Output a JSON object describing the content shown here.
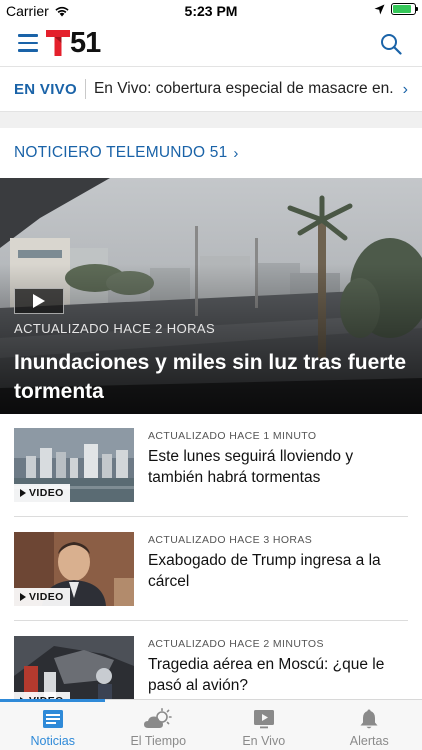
{
  "status_bar": {
    "carrier": "Carrier",
    "time": "5:23 PM",
    "battery_level": 0.85
  },
  "header": {
    "logo_number": "51"
  },
  "live": {
    "tag": "EN VIVO",
    "text": "En Vivo: cobertura especial de masacre en..."
  },
  "section": {
    "title": "NOTICIERO TELEMUNDO 51"
  },
  "hero": {
    "meta": "ACTUALIZADO HACE 2 HORAS",
    "title": "Inundaciones y miles sin luz tras fuerte tormenta"
  },
  "articles": [
    {
      "meta": "ACTUALIZADO HACE 1 MINUTO",
      "title": "Este lunes seguirá lloviendo y también habrá tormentas",
      "video_label": "VIDEO"
    },
    {
      "meta": "ACTUALIZADO HACE 3 HORAS",
      "title": "Exabogado de Trump ingresa a la cárcel",
      "video_label": "VIDEO"
    },
    {
      "meta": "ACTUALIZADO HACE 2 MINUTOS",
      "title": "Tragedia aérea en Moscú: ¿que le pasó al avión?",
      "video_label": "VIDEO"
    }
  ],
  "tabs": [
    {
      "label": "Noticias",
      "icon": "news-icon",
      "active": true
    },
    {
      "label": "El Tiempo",
      "icon": "weather-icon",
      "active": false
    },
    {
      "label": "En Vivo",
      "icon": "live-tv-icon",
      "active": false
    },
    {
      "label": "Alertas",
      "icon": "bell-icon",
      "active": false
    }
  ],
  "colors": {
    "accent": "#1a63a8",
    "tab_active": "#2f8ad8",
    "logo_red": "#e4202c"
  }
}
